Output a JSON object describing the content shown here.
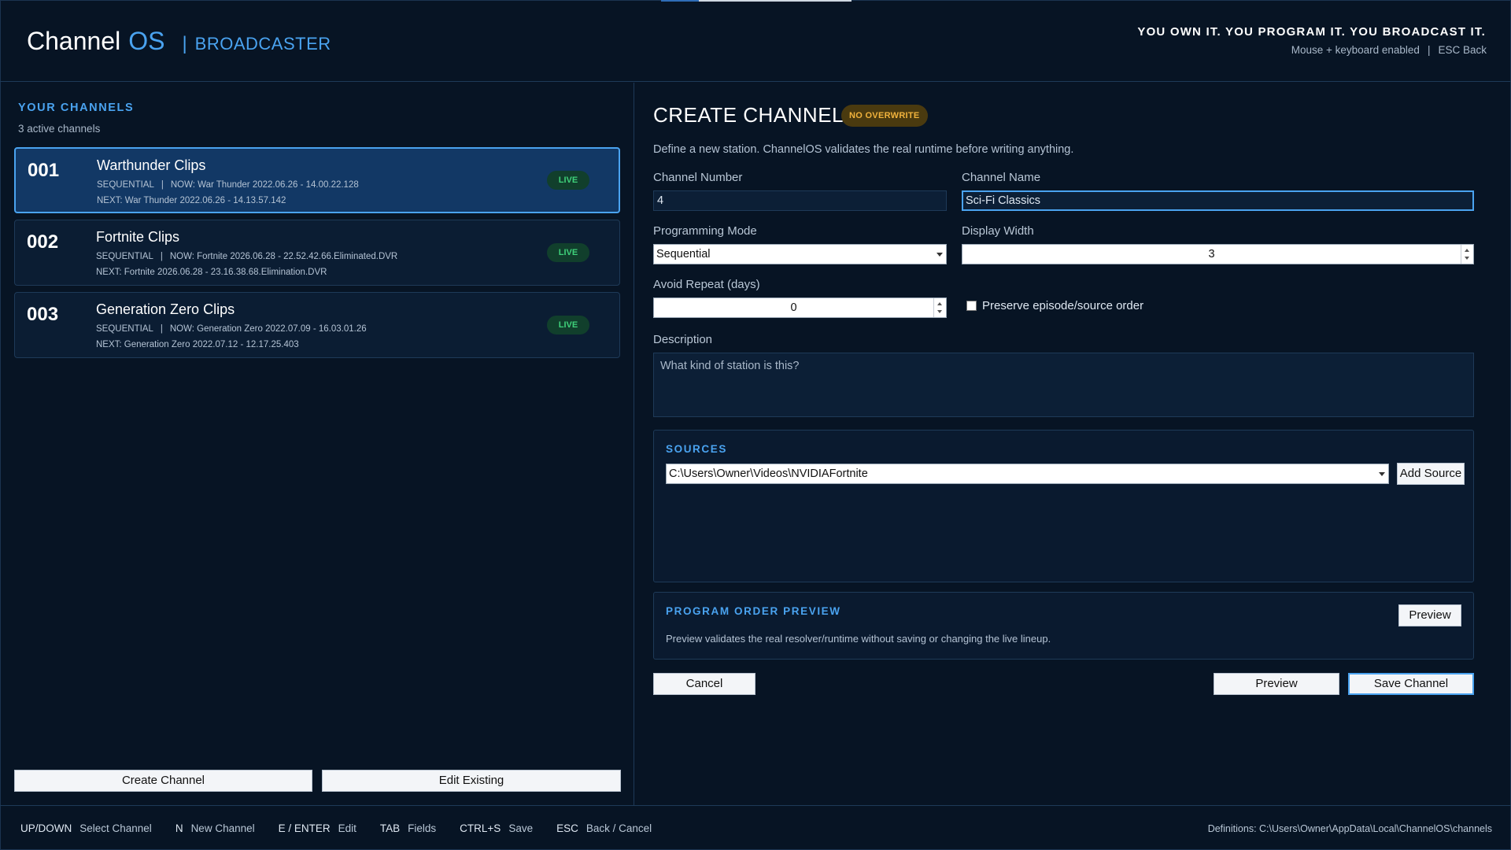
{
  "header": {
    "brand_name": "Channel",
    "brand_os": "OS",
    "brand_sep": "|",
    "brand_sub": "BROADCASTER",
    "tagline": "YOU OWN IT. YOU PROGRAM IT. YOU BROADCAST IT.",
    "hint_input": "Mouse + keyboard enabled",
    "hint_pipe": "|",
    "hint_back": "ESC Back"
  },
  "channels_panel": {
    "heading": "YOUR CHANNELS",
    "count": "3 active channels",
    "channels": [
      {
        "number": "001",
        "title": "Warthunder Clips",
        "mode": "SEQUENTIAL",
        "pipe": "|",
        "now": "NOW: War Thunder 2022.06.26 - 14.00.22.128",
        "next": "NEXT: War Thunder 2022.06.26 - 14.13.57.142",
        "status": "LIVE",
        "selected": true
      },
      {
        "number": "002",
        "title": "Fortnite Clips",
        "mode": "SEQUENTIAL",
        "pipe": "|",
        "now": "NOW: Fortnite 2026.06.28 - 22.52.42.66.Eliminated.DVR",
        "next": "NEXT: Fortnite 2026.06.28 - 23.16.38.68.Elimination.DVR",
        "status": "LIVE",
        "selected": false
      },
      {
        "number": "003",
        "title": "Generation Zero Clips",
        "mode": "SEQUENTIAL",
        "pipe": "|",
        "now": "NOW: Generation Zero 2022.07.09 - 16.03.01.26",
        "next": "NEXT: Generation Zero 2022.07.12 - 12.17.25.403",
        "status": "LIVE",
        "selected": false
      }
    ],
    "create_button": "Create Channel",
    "edit_button": "Edit Existing"
  },
  "create_form": {
    "title": "CREATE CHANNEL",
    "badge": "NO OVERWRITE",
    "description": "Define a new station. ChannelOS validates the real runtime before writing anything.",
    "channel_number_label": "Channel Number",
    "channel_number_value": "4",
    "channel_name_label": "Channel Name",
    "channel_name_value": "Sci-Fi Classics",
    "programming_mode_label": "Programming Mode",
    "programming_mode_value": "Sequential",
    "display_width_label": "Display Width",
    "display_width_value": "3",
    "avoid_repeat_label": "Avoid Repeat (days)",
    "avoid_repeat_value": "0",
    "preserve_order_label": "Preserve episode/source order",
    "preserve_order_checked": false,
    "description_label": "Description",
    "description_placeholder": "What kind of station is this?",
    "sources_heading": "SOURCES",
    "source_value": "C:\\Users\\Owner\\Videos\\NVIDIAFortnite",
    "add_source_button": "Add Source",
    "preview_heading": "PROGRAM ORDER PREVIEW",
    "preview_button": "Preview",
    "preview_note": "Preview validates the real resolver/runtime without saving or changing the live lineup.",
    "cancel_button": "Cancel",
    "preview_bottom_button": "Preview",
    "save_button": "Save Channel"
  },
  "footer": {
    "keys": [
      {
        "key": "UP/DOWN",
        "action": "Select Channel"
      },
      {
        "key": "N",
        "action": "New Channel"
      },
      {
        "key": "E / ENTER",
        "action": "Edit"
      },
      {
        "key": "TAB",
        "action": "Fields"
      },
      {
        "key": "CTRL+S",
        "action": "Save"
      },
      {
        "key": "ESC",
        "action": "Back / Cancel"
      }
    ],
    "definitions": "Definitions: C:\\Users\\Owner\\AppData\\Local\\ChannelOS\\channels"
  },
  "colors": {
    "background": "#071424",
    "accent": "#4aa3f0",
    "live_green": "#3fd07a",
    "badge_amber": "#f0b23c"
  }
}
